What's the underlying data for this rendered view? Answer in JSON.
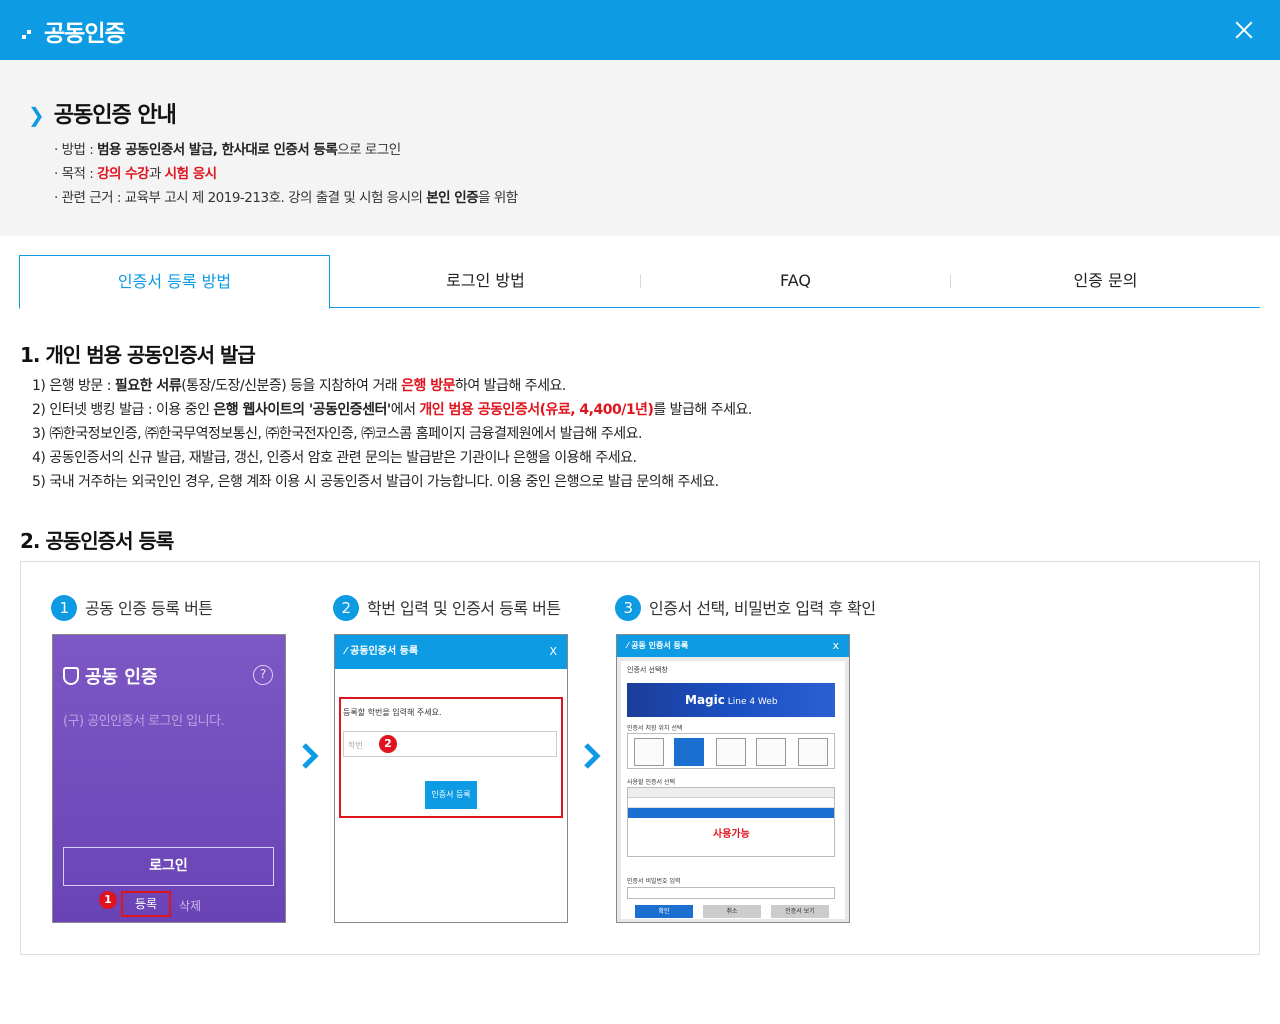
{
  "header": {
    "title": "공동인증"
  },
  "guide": {
    "title": "공동인증 안내",
    "method_prefix": "· 방법 : ",
    "method_b1": "범용 공동인증서 발급, 한사대로 인증서 등록",
    "method_suffix": "으로 로그인",
    "purpose_prefix": "· 목적 : ",
    "purpose_r1": "강의 수강",
    "purpose_mid": "과 ",
    "purpose_r2": "시험 응시",
    "basis_prefix": "· 관련 근거 : 교육부 고시 제 2019-213호. 강의 출결 및 시험 응시의 ",
    "basis_b": "본인 인증",
    "basis_suffix": "을 위함"
  },
  "tabs": [
    {
      "label": "인증서 등록 방법",
      "active": true
    },
    {
      "label": "로그인 방법"
    },
    {
      "label": "FAQ"
    },
    {
      "label": "인증 문의"
    }
  ],
  "section1": {
    "title": "1. 개인 범용 공동인증서 발급",
    "i1_a": "1)  은행 방문 : ",
    "i1_b": "필요한 서류",
    "i1_c": "(통장/도장/신분증) 등을 지참하여 거래 ",
    "i1_r": "은행 방문",
    "i1_d": "하여 발급해 주세요.",
    "i2_a": "2)  인터넷 뱅킹 발급 : 이용 중인 ",
    "i2_b": "은행 웹사이트의 '공동인증센터'",
    "i2_c": "에서 ",
    "i2_r": "개인 범용 공동인증서(유료, 4,400/1년)",
    "i2_d": "를 발급해 주세요.",
    "i3": "3)  ㈜한국정보인증, ㈜한국무역정보통신, ㈜한국전자인증, ㈜코스콤 홈페이지 금융결제원에서 발급해 주세요.",
    "i4": "4)  공동인증서의 신규 발급, 재발급, 갱신, 인증서 암호 관련 문의는 발급받은 기관이나 은행을 이용해 주세요.",
    "i5": "5)  국내 거주하는 외국인인 경우, 은행 계좌 이용 시 공동인증서 발급이 가능합니다. 이용 중인 은행으로 발급 문의해 주세요."
  },
  "section2": {
    "title": "2. 공동인증서 등록",
    "steps": [
      {
        "num": "1",
        "label": "공동 인증 등록 버튼"
      },
      {
        "num": "2",
        "label": "학번 입력 및 인증서 등록 버튼"
      },
      {
        "num": "3",
        "label": "인증서 선택, 비밀번호 입력 후 확인"
      }
    ],
    "shot1": {
      "title": "공동 인증",
      "help": "?",
      "sub": "(구) 공인인증서 로그인 입니다.",
      "login": "로그인",
      "register": "등록",
      "delete": "삭제",
      "badge": "1"
    },
    "shot2": {
      "title": "공동인증서 등록",
      "close": "X",
      "label": "등록할 학번을 입력해 주세요.",
      "placeholder": "학번",
      "button": "인증서 등록",
      "badge": "2"
    },
    "shot3": {
      "title": "공동 인증서 등록",
      "close": "x",
      "select": "인증서 선택창",
      "brand": "Magic",
      "brand_sub": " Line 4 Web",
      "location": "인증서 저장 위치 선택",
      "user_certs": "사용할 인증서 선택",
      "available": "사용가능",
      "pw_label": "인증서 비밀번호 입력",
      "ok": "확인",
      "cancel": "취소",
      "view": "인증서 보기"
    }
  },
  "colors": {
    "brand": "#0d9be3",
    "accent_red": "#e0141e",
    "purple": "#6a43b6"
  }
}
